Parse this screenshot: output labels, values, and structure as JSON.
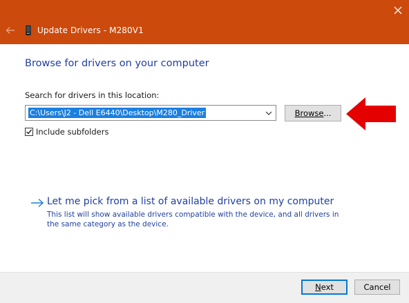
{
  "window": {
    "title": "Update Drivers - M280V1",
    "icons": {
      "back": "back-arrow-icon",
      "close": "close-icon",
      "device": "device-icon"
    },
    "accent_color": "#cc4a0c"
  },
  "page": {
    "heading": "Browse for drivers on your computer",
    "search_label": "Search for drivers in this location:",
    "path_value": "C:\\Users\\J2 - Dell E6440\\Desktop\\M280_Driver",
    "browse_label": "Browse...",
    "browse_label_parts": [
      "Browse",
      "..."
    ],
    "include_subfolders_label": "Include subfolders",
    "include_subfolders_checked": true,
    "pick_link": "Let me pick from a list of available drivers on my computer",
    "pick_description": "This list will show available drivers compatible with the device, and all drivers in the same category as the device."
  },
  "annotation": {
    "icon": "red-arrow-pointer-icon",
    "color": "#e50000"
  },
  "footer": {
    "next_label": "Next",
    "next_label_parts": [
      "N",
      "ext"
    ],
    "cancel_label": "Cancel"
  }
}
